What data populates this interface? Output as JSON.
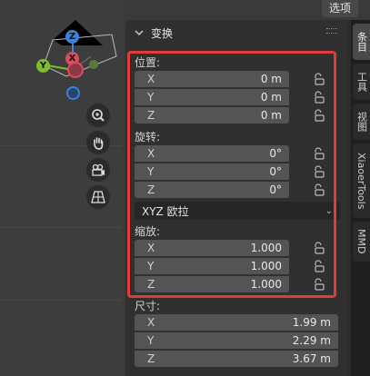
{
  "options_button": "选项",
  "panel": {
    "title": "变换",
    "location": {
      "label": "位置:",
      "rows": [
        {
          "axis": "X",
          "value": "0 m"
        },
        {
          "axis": "Y",
          "value": "0 m"
        },
        {
          "axis": "Z",
          "value": "0 m"
        }
      ]
    },
    "rotation": {
      "label": "旋转:",
      "rows": [
        {
          "axis": "X",
          "value": "0°"
        },
        {
          "axis": "Y",
          "value": "0°"
        },
        {
          "axis": "Z",
          "value": "0°"
        }
      ],
      "mode": "XYZ 欧拉"
    },
    "scale": {
      "label": "缩放:",
      "rows": [
        {
          "axis": "X",
          "value": "1.000"
        },
        {
          "axis": "Y",
          "value": "1.000"
        },
        {
          "axis": "Z",
          "value": "1.000"
        }
      ]
    },
    "dimensions": {
      "label": "尺寸:",
      "rows": [
        {
          "axis": "X",
          "value": "1.99 m"
        },
        {
          "axis": "Y",
          "value": "2.29 m"
        },
        {
          "axis": "Z",
          "value": "3.67 m"
        }
      ]
    }
  },
  "gizmo": {
    "z": "Z",
    "y": "Y",
    "x": "X"
  },
  "tabs": [
    "条目",
    "工具",
    "视图",
    "XiaoerTools",
    "MMD"
  ],
  "colors": {
    "highlight": "#e23b3b",
    "x_axis": "#e04a5c",
    "y_axis": "#7bbf2a",
    "z_axis": "#3a82e0"
  }
}
